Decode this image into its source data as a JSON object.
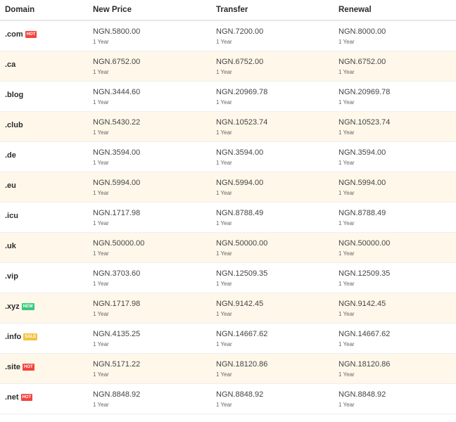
{
  "headers": {
    "domain": "Domain",
    "new_price": "New Price",
    "transfer": "Transfer",
    "renewal": "Renewal"
  },
  "badge_colors": {
    "HOT": "#f2453d",
    "NEW": "#36c97a",
    "SALE": "#f5c242"
  },
  "rows": [
    {
      "domain": ".com",
      "badge": "HOT",
      "new_price": "NGN.5800.00",
      "new_term": "1 Year",
      "transfer": "NGN.7200.00",
      "transfer_term": "1 Year",
      "renewal": "NGN.8000.00",
      "renewal_term": "1 Year"
    },
    {
      "domain": ".ca",
      "badge": "",
      "new_price": "NGN.6752.00",
      "new_term": "1 Year",
      "transfer": "NGN.6752.00",
      "transfer_term": "1 Year",
      "renewal": "NGN.6752.00",
      "renewal_term": "1 Year"
    },
    {
      "domain": ".blog",
      "badge": "",
      "new_price": "NGN.3444.60",
      "new_term": "1 Year",
      "transfer": "NGN.20969.78",
      "transfer_term": "1 Year",
      "renewal": "NGN.20969.78",
      "renewal_term": "1 Year"
    },
    {
      "domain": ".club",
      "badge": "",
      "new_price": "NGN.5430.22",
      "new_term": "1 Year",
      "transfer": "NGN.10523.74",
      "transfer_term": "1 Year",
      "renewal": "NGN.10523.74",
      "renewal_term": "1 Year"
    },
    {
      "domain": ".de",
      "badge": "",
      "new_price": "NGN.3594.00",
      "new_term": "1 Year",
      "transfer": "NGN.3594.00",
      "transfer_term": "1 Year",
      "renewal": "NGN.3594.00",
      "renewal_term": "1 Year"
    },
    {
      "domain": ".eu",
      "badge": "",
      "new_price": "NGN.5994.00",
      "new_term": "1 Year",
      "transfer": "NGN.5994.00",
      "transfer_term": "1 Year",
      "renewal": "NGN.5994.00",
      "renewal_term": "1 Year"
    },
    {
      "domain": ".icu",
      "badge": "",
      "new_price": "NGN.1717.98",
      "new_term": "1 Year",
      "transfer": "NGN.8788.49",
      "transfer_term": "1 Year",
      "renewal": "NGN.8788.49",
      "renewal_term": "1 Year"
    },
    {
      "domain": ".uk",
      "badge": "",
      "new_price": "NGN.50000.00",
      "new_term": "1 Year",
      "transfer": "NGN.50000.00",
      "transfer_term": "1 Year",
      "renewal": "NGN.50000.00",
      "renewal_term": "1 Year"
    },
    {
      "domain": ".vip",
      "badge": "",
      "new_price": "NGN.3703.60",
      "new_term": "1 Year",
      "transfer": "NGN.12509.35",
      "transfer_term": "1 Year",
      "renewal": "NGN.12509.35",
      "renewal_term": "1 Year"
    },
    {
      "domain": ".xyz",
      "badge": "NEW",
      "new_price": "NGN.1717.98",
      "new_term": "1 Year",
      "transfer": "NGN.9142.45",
      "transfer_term": "1 Year",
      "renewal": "NGN.9142.45",
      "renewal_term": "1 Year"
    },
    {
      "domain": ".info",
      "badge": "SALE",
      "new_price": "NGN.4135.25",
      "new_term": "1 Year",
      "transfer": "NGN.14667.62",
      "transfer_term": "1 Year",
      "renewal": "NGN.14667.62",
      "renewal_term": "1 Year"
    },
    {
      "domain": ".site",
      "badge": "HOT",
      "new_price": "NGN.5171.22",
      "new_term": "1 Year",
      "transfer": "NGN.18120.86",
      "transfer_term": "1 Year",
      "renewal": "NGN.18120.86",
      "renewal_term": "1 Year"
    },
    {
      "domain": ".net",
      "badge": "HOT",
      "new_price": "NGN.8848.92",
      "new_term": "1 Year",
      "transfer": "NGN.8848.92",
      "transfer_term": "1 Year",
      "renewal": "NGN.8848.92",
      "renewal_term": "1 Year"
    }
  ]
}
